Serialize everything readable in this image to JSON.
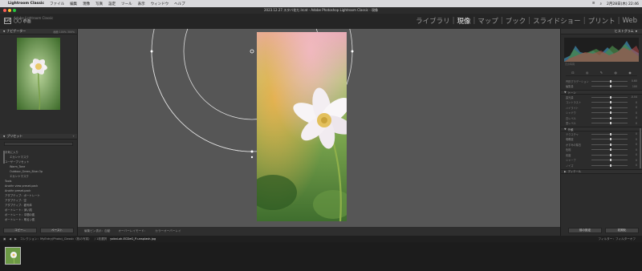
{
  "menubar": {
    "app_name": "Lightroom Classic",
    "items": [
      "ファイル",
      "編集",
      "現像",
      "写真",
      "設定",
      "ツール",
      "表示",
      "ウィンドウ",
      "ヘルプ"
    ],
    "time": "2月28日(木) 22:46"
  },
  "window": {
    "title": "2023.12.27.スタバ花だ.lrcat - Adobe Photoshop Lightroom Classic - 現像"
  },
  "identity": {
    "logo": "LrC",
    "line1": "Adobe Lightroom Classic",
    "line2": "〇〇 恭画"
  },
  "modules": [
    "ライブラリ",
    "現像",
    "マップ",
    "ブック",
    "スライドショー",
    "プリント",
    "Web"
  ],
  "left": {
    "navigator": {
      "title": "ナビゲーター",
      "zoom": "画面 100% 300%"
    },
    "presets": {
      "title": "プリセット",
      "items": [
        {
          "label": "お気に入り",
          "indent": false
        },
        {
          "label": "エカントマスク",
          "indent": true
        },
        {
          "label": "ユーザープリセット",
          "indent": false
        },
        {
          "label": "Warm_Tone",
          "indent": true
        },
        {
          "label": "Outdoor_Green_Blue-Op",
          "indent": true
        },
        {
          "label": "エカントマスク",
          "indent": true
        },
        {
          "label": "Tools",
          "indent": false
        },
        {
          "label": "Anothr view preset.pack",
          "indent": false
        },
        {
          "label": "Anothr preset.pack",
          "indent": false
        },
        {
          "label": "アダプティブ：ポートレート",
          "indent": false
        },
        {
          "label": "アダプティブ：空",
          "indent": false
        },
        {
          "label": "アダプティブ：被写体",
          "indent": false
        },
        {
          "label": "ポートレート：深い肌",
          "indent": false
        },
        {
          "label": "ポートレート：中間の肌",
          "indent": false
        },
        {
          "label": "ポートレート：明るい肌",
          "indent": false
        }
      ]
    },
    "buttons": {
      "copy": "コピー...",
      "paste": "ペースト"
    }
  },
  "center_toolbar": {
    "items": [
      "編集ピン表示：自動",
      "オーバーレイモード：",
      "カラーオーバーレイ"
    ]
  },
  "right": {
    "histogram_title": "ヒストグラム",
    "histogram_info": "元の写真",
    "tools": [
      "⊡",
      "◎",
      "✎",
      "◍",
      "◉"
    ],
    "rows_a": [
      {
        "label": "円形グラデーション",
        "value": "0.60"
      },
      {
        "label": "編集量",
        "value": "100"
      }
    ],
    "section_tone": "トーン",
    "rows_tone": [
      {
        "label": "露光量",
        "value": "-0.04"
      },
      {
        "label": "コントラスト",
        "value": "0"
      },
      {
        "label": "ハイライト",
        "value": "0"
      },
      {
        "label": "シャドウ",
        "value": "0"
      },
      {
        "label": "白レベル",
        "value": "0"
      },
      {
        "label": "黒レベル",
        "value": "0"
      }
    ],
    "section_presence": "外観",
    "rows_presence": [
      {
        "label": "テクスチャ",
        "value": "0"
      },
      {
        "label": "明瞭度",
        "value": "0"
      },
      {
        "label": "かすみの除去",
        "value": "0"
      },
      {
        "label": "色相",
        "value": "0"
      },
      {
        "label": "彩度",
        "value": "0"
      },
      {
        "label": "シャープ",
        "value": "0"
      },
      {
        "label": "ノイズ",
        "value": "0"
      }
    ],
    "section_detail": "ディテール",
    "buttons": {
      "previous": "前の設定",
      "reset": "初期化"
    }
  },
  "filmstrip_bar": {
    "items": [
      "コレクション：MyEntry(Photo)_Classic（枚の写真）",
      "/ 1枚選択",
      "yokai-ok-ECDeG_P-unsplash.jpg"
    ],
    "filter": "フィルター：フィルターオフ"
  },
  "colors": {
    "bg": "#565656",
    "panel": "#2c2c2c",
    "accent": "#eeeeee"
  }
}
